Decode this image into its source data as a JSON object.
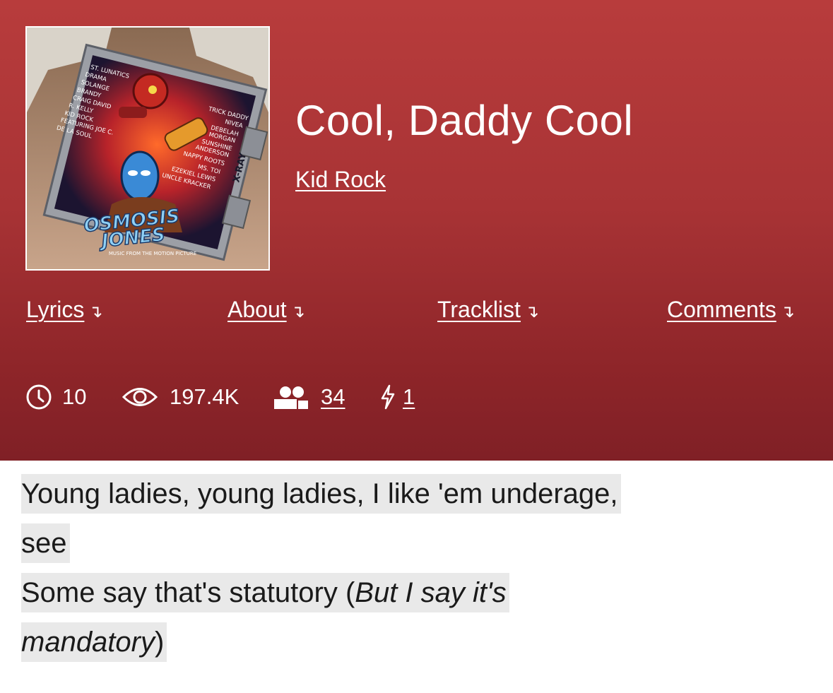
{
  "song": {
    "title": "Cool, Daddy Cool",
    "artist": "Kid Rock"
  },
  "cover": {
    "alt": "Osmosis Jones – Music from the Motion Picture",
    "artists_left": [
      "ST. LUNATICS",
      "DRAMA",
      "SOLANGE",
      "BRANDY",
      "CRAIG DAVID",
      "R. KELLY",
      "KID ROCK",
      "FEATURING JOE C.",
      "DE LA SOUL"
    ],
    "artists_right": [
      "TRICK DADDY",
      "NIVEA",
      "DEBELAH",
      "MORGAN",
      "SUNSHINE",
      "ANDERSON",
      "NAPPY ROOTS",
      "MS. TOI",
      "EZEKIEL LEWIS",
      "UNCLE KRACKER"
    ],
    "xray_label": "X-RAY",
    "logo_line1": "OSMOSIS",
    "logo_line2": "JONES",
    "subtitle": "MUSIC FROM THE MOTION PICTURE"
  },
  "nav": {
    "lyrics": "Lyrics",
    "about": "About",
    "tracklist": "Tracklist",
    "comments": "Comments",
    "arrow": "↴"
  },
  "stats": {
    "transcribers": "10",
    "views": "197.4K",
    "contributors": "34",
    "pyongs": "1"
  },
  "lyrics": {
    "line1": "Young ladies, young ladies, I like 'em underage,",
    "line2": "see",
    "line3_plain": "Some say that's statutory (",
    "line3_italic": "But I say it's",
    "line4_italic": "mandatory",
    "line4_close": ")"
  },
  "colors": {
    "header_top": "#b83c3c",
    "header_bottom": "#802026",
    "highlight": "#e9e9e9"
  }
}
